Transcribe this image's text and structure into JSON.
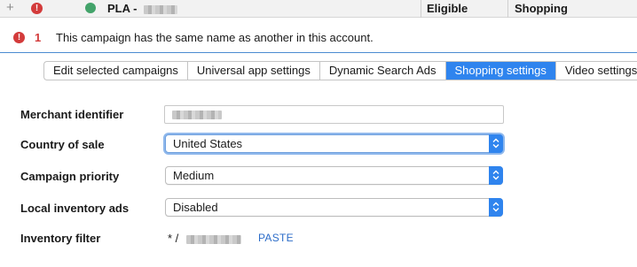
{
  "top_row": {
    "campaign_name": "PLA -",
    "status": "Eligible",
    "type": "Shopping"
  },
  "warning": {
    "count": "1",
    "message": "This campaign has the same name as another in this account."
  },
  "tabs": [
    {
      "label": "Edit selected campaigns",
      "active": false
    },
    {
      "label": "Universal app settings",
      "active": false
    },
    {
      "label": "Dynamic Search Ads",
      "active": false
    },
    {
      "label": "Shopping settings",
      "active": true
    },
    {
      "label": "Video settings",
      "active": false
    }
  ],
  "form": {
    "merchant_identifier": {
      "label": "Merchant identifier"
    },
    "country_of_sale": {
      "label": "Country of sale",
      "value": "United States"
    },
    "campaign_priority": {
      "label": "Campaign priority",
      "value": "Medium"
    },
    "local_inventory_ads": {
      "label": "Local inventory ads",
      "value": "Disabled"
    },
    "inventory_filter": {
      "label": "Inventory filter",
      "value": "* /",
      "paste_label": "PASTE"
    }
  },
  "colors": {
    "accent": "#2f84ee",
    "error": "#d33b3b",
    "status_ok": "#43a36a",
    "link": "#2b6cc8"
  }
}
